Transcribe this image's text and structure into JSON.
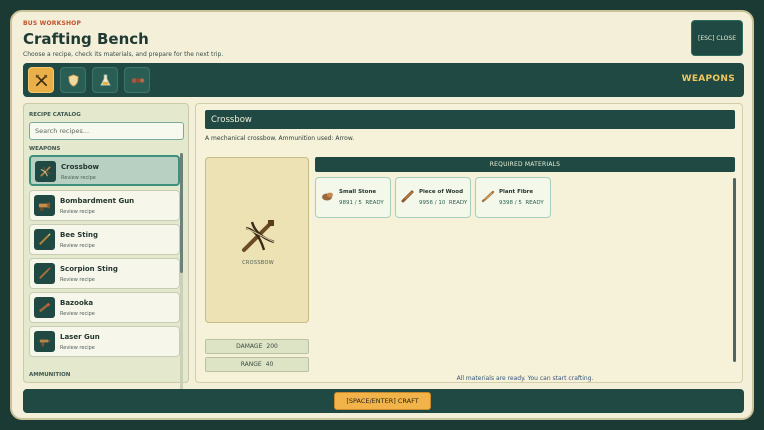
{
  "header": {
    "kicker": "BUS WORKSHOP",
    "title": "Crafting Bench",
    "subtitle": "Choose a recipe, check its materials, and prepare for the next trip.",
    "close_label": "[ESC] CLOSE"
  },
  "tabs": [
    {
      "icon": "crossed-tools-icon",
      "active": true
    },
    {
      "icon": "shield-icon",
      "active": false
    },
    {
      "icon": "flask-icon",
      "active": false
    },
    {
      "icon": "ammo-icon",
      "active": false
    }
  ],
  "tab_title": "WEAPONS",
  "catalog": {
    "label": "RECIPE CATALOG",
    "search_placeholder": "Search recipes...",
    "groups": [
      {
        "label": "WEAPONS",
        "items": [
          {
            "name": "Crossbow",
            "sub": "Review recipe",
            "icon": "crossbow-icon",
            "selected": true
          },
          {
            "name": "Bombardment Gun",
            "sub": "Review recipe",
            "icon": "cannon-icon",
            "selected": false
          },
          {
            "name": "Bee Sting",
            "sub": "Review recipe",
            "icon": "sting-icon",
            "selected": false
          },
          {
            "name": "Scorpion Sting",
            "sub": "Review recipe",
            "icon": "scorpion-sting-icon",
            "selected": false
          },
          {
            "name": "Bazooka",
            "sub": "Review recipe",
            "icon": "bazooka-icon",
            "selected": false
          },
          {
            "name": "Laser Gun",
            "sub": "Review recipe",
            "icon": "laser-gun-icon",
            "selected": false
          }
        ]
      },
      {
        "label": "AMMUNITION",
        "items": []
      }
    ]
  },
  "detail": {
    "title": "Crossbow",
    "description": "A mechanical crossbow. Ammunition used: Arrow.",
    "preview_label": "CROSSBOW",
    "stats": [
      {
        "label": "DAMAGE",
        "value": "200"
      },
      {
        "label": "RANGE",
        "value": "40"
      }
    ],
    "materials_header": "REQUIRED MATERIALS",
    "materials": [
      {
        "name": "Small Stone",
        "qty": "9891 / 5",
        "status": "READY",
        "icon": "stone-icon"
      },
      {
        "name": "Piece of Wood",
        "qty": "9956 / 10",
        "status": "READY",
        "icon": "wood-icon"
      },
      {
        "name": "Plant Fibre",
        "qty": "9398 / 5",
        "status": "READY",
        "icon": "fibre-icon"
      }
    ],
    "status": "All materials are ready. You can start crafting."
  },
  "footer": {
    "craft_label": "[SPACE/ENTER] CRAFT"
  },
  "colors": {
    "accent": "#f1b34a",
    "panel_dark": "#1f4942",
    "panel_light": "#f3efd9",
    "selected": "#b7d0c1"
  }
}
